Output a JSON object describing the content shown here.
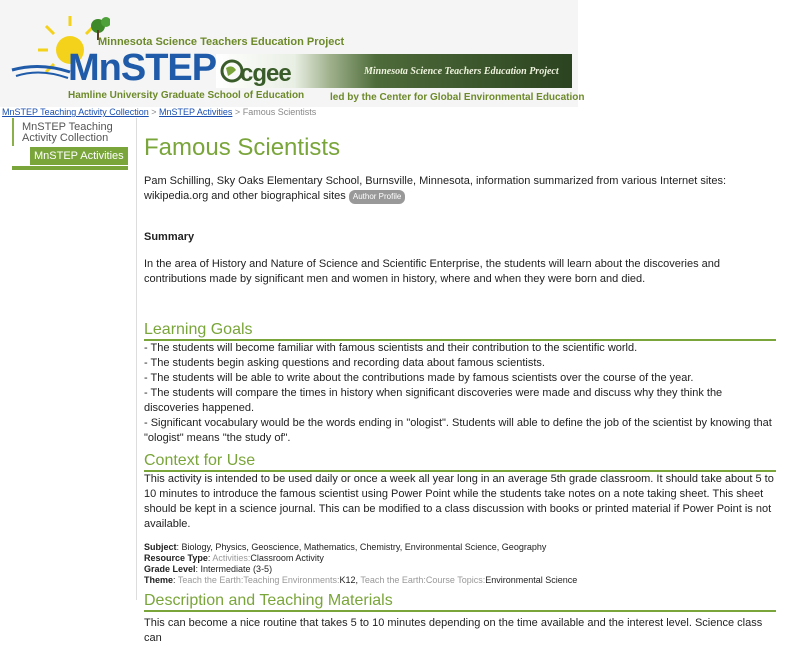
{
  "banner": {
    "top_line": "Minnesota Science Teachers Education Project",
    "logo_text": "MnSTEP",
    "school": "Hamline University Graduate School of Education",
    "cgee_logo": "cgee",
    "cgee_tag": "Minnesota Science Teachers Education Project",
    "cgee_bottom": "led by the Center for Global Environmental Education"
  },
  "breadcrumb": {
    "link1": "MnSTEP Teaching Activity Collection",
    "sep1": ">",
    "link2": "MnSTEP Activities",
    "sep2": ">",
    "current": "Famous Scientists"
  },
  "sidebar": {
    "items": [
      {
        "label": "MnSTEP Teaching Activity Collection"
      },
      {
        "label": "MnSTEP Activities"
      }
    ]
  },
  "main": {
    "title": "Famous Scientists",
    "author_line": "Pam Schilling, Sky Oaks Elementary School, Burnsville, Minnesota, information summarized from various Internet sites: wikipedia.org and other biographical sites",
    "author_badge": "Author Profile",
    "summary_heading": "Summary",
    "summary_text": "In the area of History and Nature of Science and Scientific Enterprise, the students will learn about the discoveries and contributions made by significant men and women in history, where and when they were born and died.",
    "goals_heading": "Learning Goals",
    "goals": [
      "- The students will become familiar with famous scientists and their contribution to the scientific world.",
      "- The students begin asking questions and recording data about famous scientists.",
      "- The students will be able to write about the contributions made by famous scientists over the course of the year.",
      "- The students will compare the times in history when significant discoveries were made and discuss why they think the discoveries happened.",
      "- Significant vocabulary would be the words ending in \"ologist\". Students will able to define the job of the scientist by knowing that \"ologist\" means \"the study of\"."
    ],
    "context_heading": "Context for Use",
    "context_text": "This activity is intended to be used daily or once a week all year long in an average 5th grade classroom. It should take about 5 to 10 minutes to introduce the famous scientist using Power Point while the students take notes on a note taking sheet. This sheet should be kept in a science journal. This can be modified to a class discussion with books or printed material if Power Point is not available.",
    "meta": {
      "subject_label": "Subject",
      "subject_value": ": Biology, Physics, Geoscience, Mathematics, Chemistry, Environmental Science, Geography",
      "resource_label": "Resource Type",
      "resource_prefix": "Activities:",
      "resource_value": "Classroom Activity",
      "grade_label": "Grade Level",
      "grade_value": ": Intermediate (3-5)",
      "theme_label": "Theme",
      "theme_prefix1": "Teach the Earth:Teaching Environments:",
      "theme_value1": "K12, ",
      "theme_prefix2": "Teach the Earth:Course Topics:",
      "theme_value2": "Environmental Science"
    },
    "desc_heading": "Description and Teaching Materials",
    "desc_text": "This can become a nice routine that takes 5 to 10 minutes depending on the time available and the interest level. Science class can"
  },
  "colors": {
    "accent_green": "#7aa53a",
    "link_blue": "#1a4fb0",
    "logo_blue": "#1f5ba8"
  }
}
